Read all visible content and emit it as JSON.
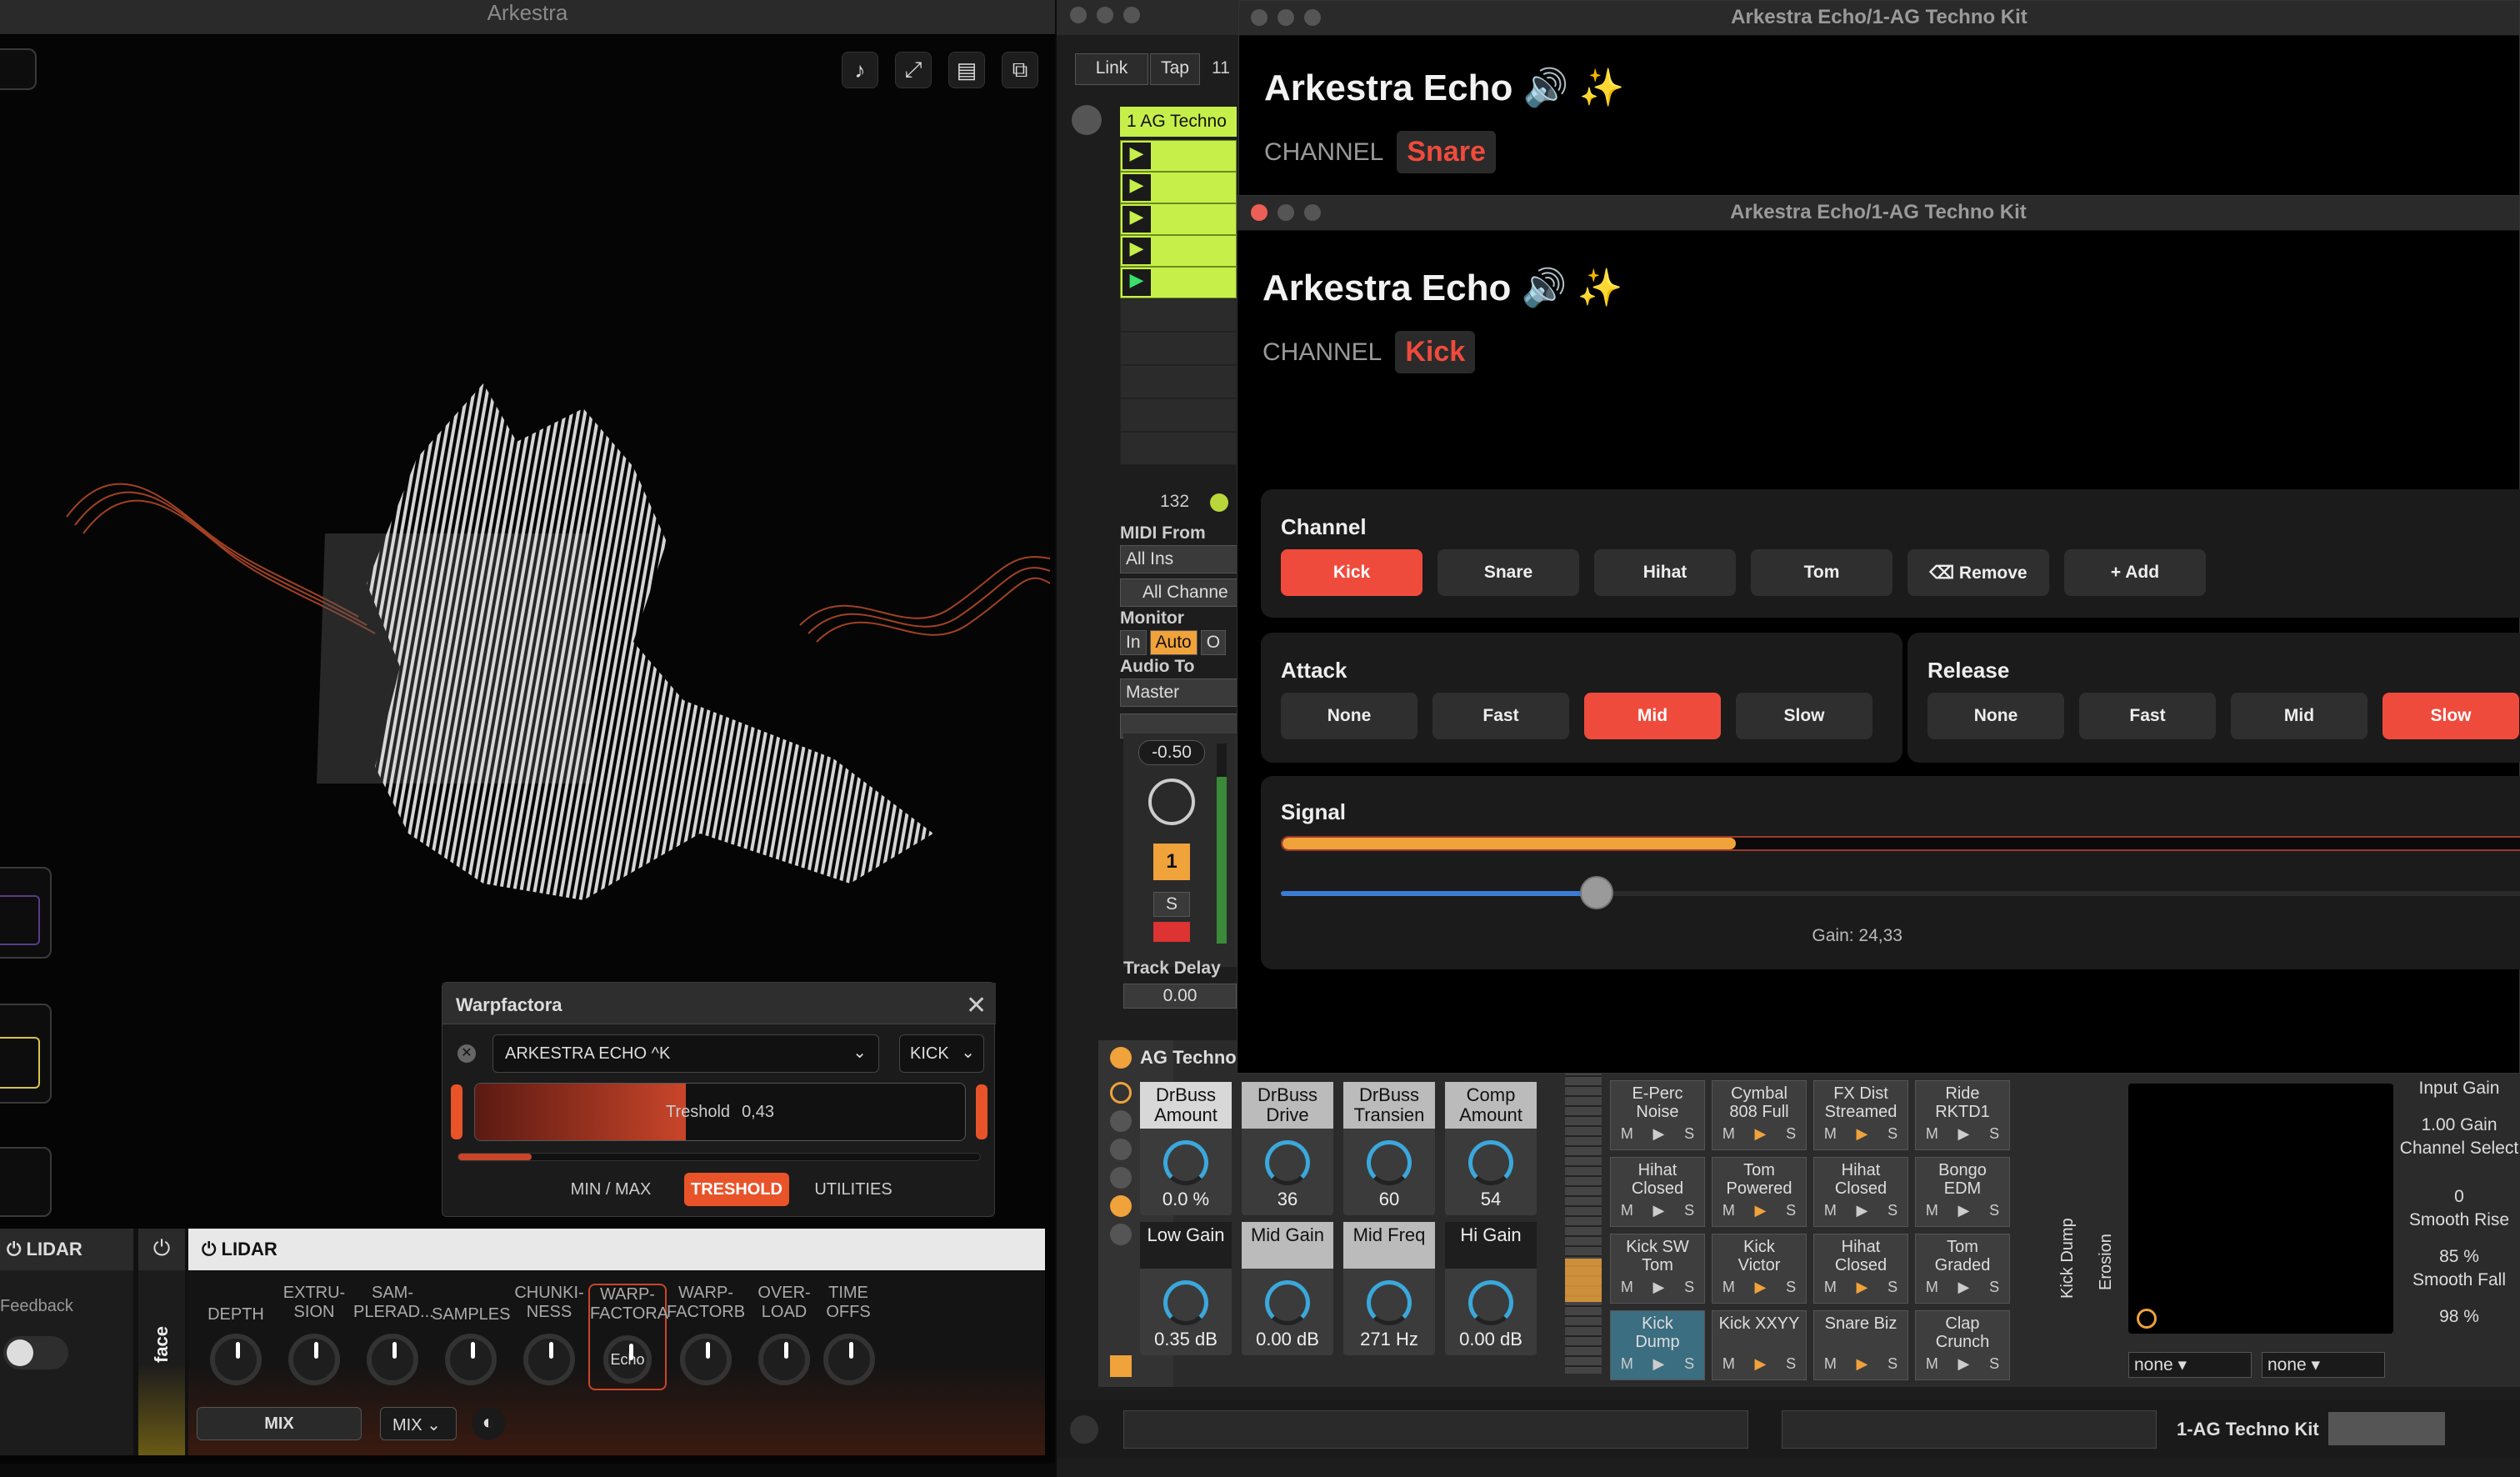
{
  "left_window": {
    "title": "Arkestra",
    "toolbar_icons": [
      "music-note-icon",
      "expand-icon",
      "window-icon",
      "windows-icon"
    ],
    "warp_panel": {
      "title": "Warpfactora",
      "device_select": "ARKESTRA ECHO ^K",
      "channel_select": "KICK",
      "slider_label": "Treshold",
      "slider_value": "0,43",
      "slider_level": 0.43,
      "tabs": [
        "MIN / MAX",
        "TRESHOLD",
        "UTILITIES"
      ],
      "active_tab": "TRESHOLD"
    },
    "side_panel": {
      "title": "LIDAR",
      "feedback_label": "Feedback"
    },
    "lidar_panel": {
      "title": "LIDAR",
      "face_label": "face",
      "params": [
        "DEPTH",
        "EXTRU-\nSION",
        "SAM-\nPLERAD...",
        "SAMPLES",
        "CHUNKI-\nNESS",
        "WARP-\nFACTORA",
        "WARP-\nFACTORB",
        "OVER-\nLOAD",
        "TIME\nOFFS"
      ],
      "highlight_label": "Echo",
      "mix_label": "MIX",
      "mix_select": "MIX"
    }
  },
  "ableton": {
    "link_label": "Link",
    "tap_label": "Tap",
    "num": "11",
    "track_name": "1 AG Techno",
    "tempo": "132",
    "midi_from_label": "MIDI From",
    "midi_from": "All Ins",
    "channels": "All Channe",
    "monitor_label": "Monitor",
    "monitor_opts": [
      "In",
      "Auto",
      "O"
    ],
    "audio_to_label": "Audio To",
    "audio_to": "Master",
    "pan": "-0.50",
    "track_num": "1",
    "solo": "S",
    "track_delay_label": "Track Delay",
    "track_delay": "0.00",
    "device_title": "AG Techno",
    "macros": [
      {
        "name": "DrBuss\nAmount",
        "value": "0.0 %"
      },
      {
        "name": "DrBuss\nDrive",
        "value": "36"
      },
      {
        "name": "DrBuss\nTransien",
        "value": "60"
      },
      {
        "name": "Comp\nAmount",
        "value": "54"
      },
      {
        "name": "Low Gain",
        "value": "0.35 dB"
      },
      {
        "name": "Mid Gain",
        "value": "0.00 dB"
      },
      {
        "name": "Mid Freq",
        "value": "271 Hz"
      },
      {
        "name": "Hi Gain",
        "value": "0.00 dB"
      }
    ],
    "pads": [
      "E-Perc\nNoise",
      "Cymbal\n808 Full",
      "FX Dist\nStreamed",
      "Ride\nRKTD1",
      "Hihat\nClosed",
      "Tom\nPowered",
      "Hihat\nClosed",
      "Bongo\nEDM",
      "Kick SW\nTom",
      "Kick\nVictor",
      "Hihat\nClosed",
      "Tom\nGraded",
      "Kick\nDump",
      "Kick XXYY",
      "Snare Biz",
      "Clap\nCrunch"
    ],
    "pad_ms": [
      "M",
      "▶",
      "S"
    ],
    "kick_dump_label": "Kick Dump",
    "erosion_label": "Erosion",
    "input_gain_label": "Input Gain",
    "input_gain": "1.00 Gain",
    "channel_select_label": "Channel Select",
    "channel_select": "0",
    "smooth_rise_label": "Smooth Rise",
    "smooth_rise": "85 %",
    "smooth_fall_label": "Smooth Fall",
    "smooth_fall": "98 %",
    "none1": "none",
    "none2": "none",
    "footer_track": "1-AG Techno Kit"
  },
  "echo_back": {
    "title": "Arkestra Echo/1-AG Techno Kit",
    "heading": "Arkestra Echo 🔊 ✨",
    "channel_label": "CHANNEL",
    "channel": "Snare"
  },
  "echo_front": {
    "title": "Arkestra Echo/1-AG Techno Kit",
    "heading": "Arkestra Echo 🔊 ✨",
    "channel_label": "CHANNEL",
    "channel": "Kick",
    "channel_card": {
      "title": "Channel",
      "buttons": [
        "Kick",
        "Snare",
        "Hihat",
        "Tom",
        "⌫ Remove",
        "+ Add"
      ],
      "active": "Kick"
    },
    "attack_card": {
      "title": "Attack",
      "buttons": [
        "None",
        "Fast",
        "Mid",
        "Slow"
      ],
      "active": "Mid"
    },
    "release_card": {
      "title": "Release",
      "buttons": [
        "None",
        "Fast",
        "Mid",
        "Slow"
      ],
      "active": "Slow"
    },
    "signal_card": {
      "title": "Signal",
      "signal_level": 0.36,
      "gain_label": "Gain: 24,33",
      "gain_level": 0.25
    }
  },
  "colors": {
    "accent": "#ef4b3c",
    "orange": "#f0a23b",
    "blue": "#3a7bd5",
    "lime": "#c6ef4a"
  }
}
